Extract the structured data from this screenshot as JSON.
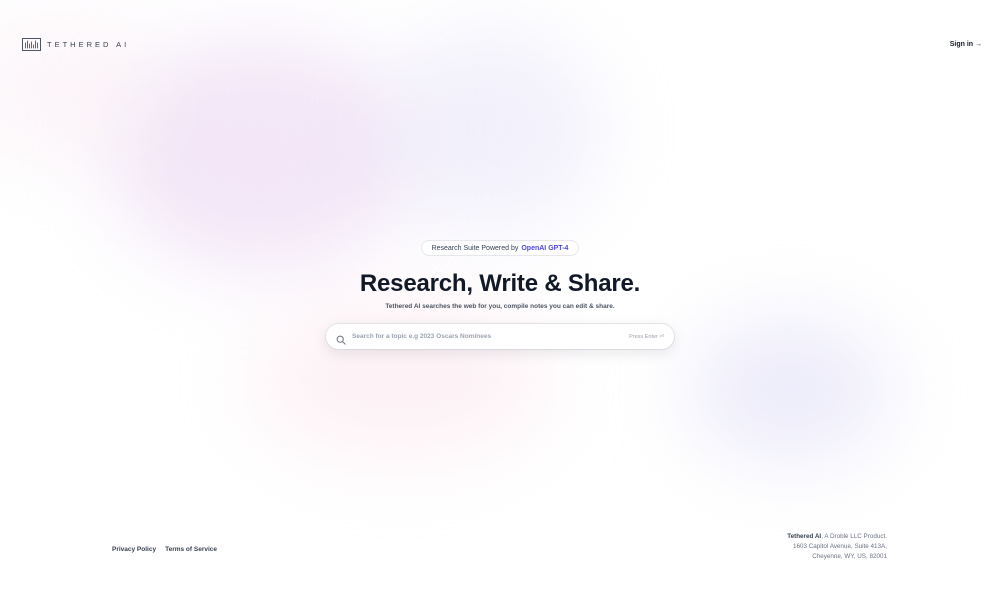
{
  "header": {
    "logo_text": "TETHERED AI",
    "signin_label": "Sign in →"
  },
  "hero": {
    "badge_prefix": "Research Suite Powered by",
    "badge_accent": "OpenAI GPT-4",
    "title": "Research, Write & Share.",
    "subtitle": "Tethered AI searches the web for you, compile notes you can edit & share."
  },
  "search": {
    "placeholder": "Search for a topic e.g 2023 Oscars Nominees",
    "value": "",
    "hint": "Press Enter ⏎"
  },
  "footer": {
    "privacy_label": "Privacy Policy",
    "terms_label": "Terms of Service",
    "company": "Tethered AI",
    "company_suffix": ", A Droble LLC Product.",
    "address_line1": "1603 Capitol Avenue, Suite 413A,",
    "address_line2": "Cheyenne, WY, US, 82001"
  },
  "colors": {
    "accent": "#4f46e5",
    "text": "#111827",
    "muted": "#6b7280"
  },
  "icons": {
    "logo": "waveform-logo-icon",
    "search": "search-icon"
  }
}
